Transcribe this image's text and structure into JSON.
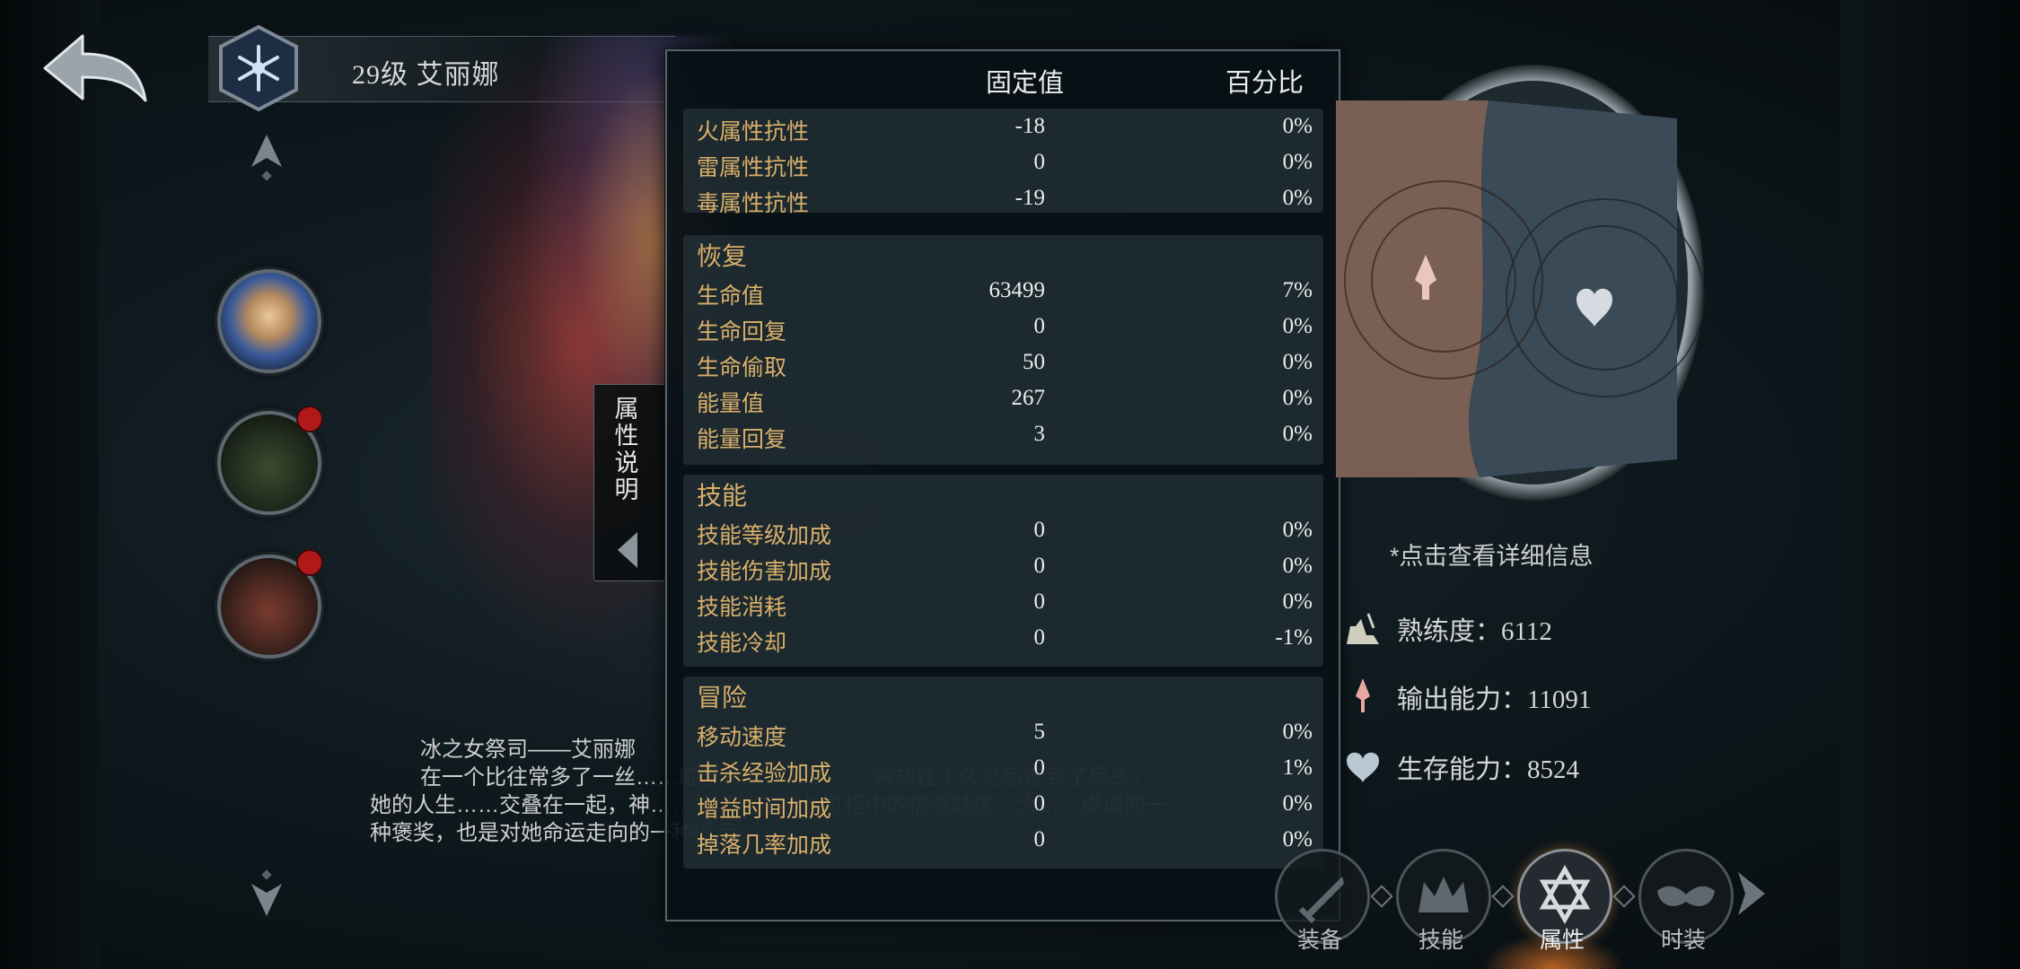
{
  "header": {
    "hero_name": "29级 艾丽娜"
  },
  "side_tab": {
    "label": "属性说明"
  },
  "description": {
    "line1": "冰之女祭司——艾丽娜",
    "line2": "在一个比往常多了一丝……临于世。家族的……荣却在不久之后走到了尽头，她的人生……交叠在一起，神……补了她在成长过程中的情感缺失。大……虔诚的一种褒奖，也是对她命运走向的一种提示。"
  },
  "stats": {
    "headers": {
      "fixed": "固定值",
      "percent": "百分比"
    },
    "resist": [
      {
        "label": "火属性抗性",
        "fixed": "-18",
        "percent": "0%"
      },
      {
        "label": "雷属性抗性",
        "fixed": "0",
        "percent": "0%"
      },
      {
        "label": "毒属性抗性",
        "fixed": "-19",
        "percent": "0%"
      }
    ],
    "recovery": {
      "title": "恢复",
      "rows": [
        {
          "label": "生命值",
          "fixed": "63499",
          "percent": "7%"
        },
        {
          "label": "生命回复",
          "fixed": "0",
          "percent": "0%"
        },
        {
          "label": "生命偷取",
          "fixed": "50",
          "percent": "0%"
        },
        {
          "label": "能量值",
          "fixed": "267",
          "percent": "0%"
        },
        {
          "label": "能量回复",
          "fixed": "3",
          "percent": "0%"
        }
      ]
    },
    "skill": {
      "title": "技能",
      "rows": [
        {
          "label": "技能等级加成",
          "fixed": "0",
          "percent": "0%"
        },
        {
          "label": "技能伤害加成",
          "fixed": "0",
          "percent": "0%"
        },
        {
          "label": "技能消耗",
          "fixed": "0",
          "percent": "0%"
        },
        {
          "label": "技能冷却",
          "fixed": "0",
          "percent": "-1%"
        }
      ]
    },
    "adventure": {
      "title": "冒险",
      "rows": [
        {
          "label": "移动速度",
          "fixed": "5",
          "percent": "0%"
        },
        {
          "label": "击杀经验加成",
          "fixed": "0",
          "percent": "1%"
        },
        {
          "label": "增益时间加成",
          "fixed": "0",
          "percent": "0%"
        },
        {
          "label": "掉落几率加成",
          "fixed": "0",
          "percent": "0%"
        }
      ]
    }
  },
  "right_panel": {
    "hint": "*点击查看详细信息",
    "mastery": "熟练度：6112",
    "output": "输出能力：11091",
    "survival": "生存能力：8524"
  },
  "bottom_nav": {
    "items": [
      {
        "label": "装备",
        "icon": "sword-icon"
      },
      {
        "label": "技能",
        "icon": "crown-icon"
      },
      {
        "label": "属性",
        "icon": "hexagram-icon"
      },
      {
        "label": "时装",
        "icon": "mask-icon"
      }
    ],
    "active": "属性"
  },
  "colors": {
    "label_gold": "#d9b06b",
    "panel_bg": "#08141a",
    "group_bg": "#2e3e46",
    "text_white": "#ececec"
  }
}
